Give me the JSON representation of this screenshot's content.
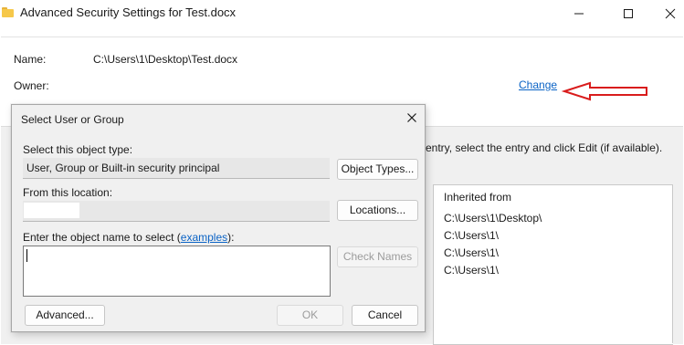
{
  "window": {
    "title": "Advanced Security Settings for Test.docx",
    "name_label": "Name:",
    "name_value": "C:\\Users\\1\\Desktop\\Test.docx",
    "owner_label": "Owner:",
    "change_link": "Change",
    "instruction_fragment": "entry, select the entry and click Edit (if available).",
    "list_header": "Inherited from",
    "inherited_from": [
      "C:\\Users\\1\\Desktop\\",
      "C:\\Users\\1\\",
      "C:\\Users\\1\\",
      "C:\\Users\\1\\"
    ]
  },
  "annotation": {
    "arrow_color": "#d91c1c"
  },
  "dialog": {
    "title": "Select User or Group",
    "object_type_label": "Select this object type:",
    "object_type_value": "User, Group or Built-in security principal",
    "object_types_button": "Object Types...",
    "location_label": "From this location:",
    "location_value": "",
    "locations_button": "Locations...",
    "enter_label_prefix": "Enter the object name to select (",
    "examples_link": "examples",
    "enter_label_suffix": "):",
    "object_name_value": "",
    "check_names_button": "Check Names",
    "advanced_button": "Advanced...",
    "ok_button": "OK",
    "cancel_button": "Cancel"
  },
  "colors": {
    "link": "#0b63c5",
    "dialog_bg": "#f0f0f0"
  }
}
